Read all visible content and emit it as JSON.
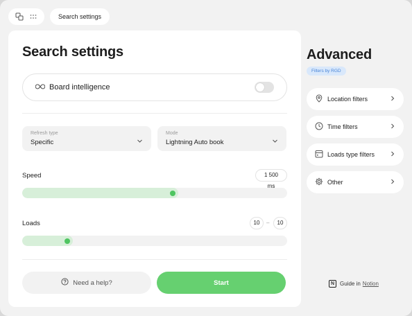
{
  "breadcrumb": {
    "current": "Search settings"
  },
  "card": {
    "title": "Search settings",
    "board_intelligence": {
      "label": "Board intelligence",
      "enabled": false
    },
    "refresh_type": {
      "label": "Refresh type",
      "value": "Specific"
    },
    "mode": {
      "label": "Mode",
      "value": "Lightning Auto book"
    },
    "speed": {
      "label": "Speed",
      "value": "1 500 ms",
      "fill_fraction": 0.59
    },
    "loads": {
      "label": "Loads",
      "min": "10",
      "separator": "–",
      "max": "10",
      "fill_fraction": 0.19
    },
    "help_button": "Need a help?",
    "start_button": "Start"
  },
  "advanced": {
    "title": "Advanced",
    "badge": "Filters by RGD",
    "filters": [
      {
        "label": "Location filters",
        "icon": "location-pin-icon"
      },
      {
        "label": "Time filters",
        "icon": "clock-icon"
      },
      {
        "label": "Loads type filters",
        "icon": "calendar-icon"
      },
      {
        "label": "Other",
        "icon": "gear-icon"
      }
    ]
  },
  "guide": {
    "prefix": "Guide in",
    "link": "Notion"
  },
  "colors": {
    "accent_green": "#66d070",
    "slider_fill": "#d7efd9",
    "badge_bg": "#d9e8fb",
    "badge_text": "#4a86d8"
  }
}
